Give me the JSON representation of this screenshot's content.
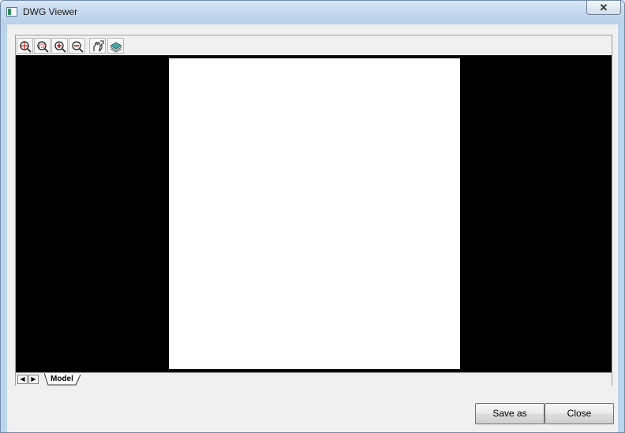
{
  "window": {
    "title": "DWG Viewer",
    "close_glyph": "✕"
  },
  "toolbar": {
    "buttons": [
      {
        "name": "zoom-extents-icon",
        "tooltip": ""
      },
      {
        "name": "zoom-window-icon",
        "tooltip": ""
      },
      {
        "name": "zoom-in-icon",
        "tooltip": ""
      },
      {
        "name": "zoom-out-icon",
        "tooltip": ""
      },
      {
        "name": "pan-hand-icon",
        "tooltip": ""
      },
      {
        "name": "layers-icon",
        "tooltip": ""
      }
    ]
  },
  "layout_tabs": {
    "prev_glyph": "◀",
    "next_glyph": "▶",
    "active_tab": "Model"
  },
  "colors": {
    "canvas": "#000000",
    "paper": "#ffffff",
    "chrome": "#f0f0f0"
  },
  "footer": {
    "save_as_label": "Save as",
    "close_label": "Close"
  }
}
